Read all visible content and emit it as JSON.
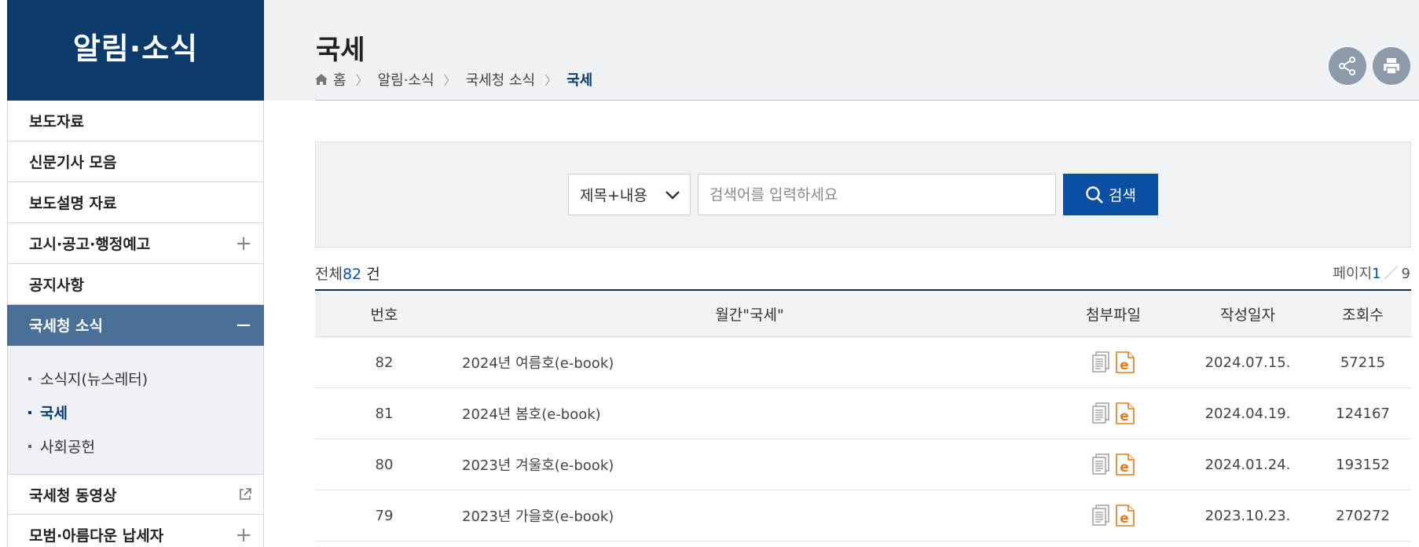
{
  "sidebar": {
    "title": "알림·소식",
    "items": [
      {
        "label": "보도자료",
        "icon": ""
      },
      {
        "label": "신문기사 모음",
        "icon": ""
      },
      {
        "label": "보도설명 자료",
        "icon": ""
      },
      {
        "label": "고시·공고·행정예고",
        "icon": "+"
      },
      {
        "label": "공지사항",
        "icon": ""
      },
      {
        "label": "국세청 소식",
        "icon": "−"
      }
    ],
    "submenu": [
      "소식지(뉴스레터)",
      "국세",
      "사회공헌"
    ],
    "bottom_items": [
      {
        "label": "국세청 동영상"
      },
      {
        "label": "모범·아름다운 납세자",
        "icon": "+"
      }
    ]
  },
  "header": {
    "title": "국세",
    "breadcrumb": [
      "홈",
      "알림·소식",
      "국세청 소식",
      "국세"
    ]
  },
  "search": {
    "select_value": "제목+내용",
    "placeholder": "검색어를 입력하세요",
    "button_label": "검색"
  },
  "summary": {
    "total_label": "전체",
    "total_count": "82",
    "total_unit": " 건",
    "page_label": "페이지",
    "page_current": "1",
    "page_sep": "／",
    "page_total": "9"
  },
  "table": {
    "headers": {
      "no": "번호",
      "title": "월간\"국세\"",
      "file": "첨부파일",
      "date": "작성일자",
      "views": "조회수"
    },
    "rows": [
      {
        "no": "82",
        "title": "2024년 여름호(e-book)",
        "date": "2024.07.15.",
        "views": "57215"
      },
      {
        "no": "81",
        "title": "2024년 봄호(e-book)",
        "date": "2024.04.19.",
        "views": "124167"
      },
      {
        "no": "80",
        "title": "2023년 겨울호(e-book)",
        "date": "2024.01.24.",
        "views": "193152"
      },
      {
        "no": "79",
        "title": "2023년 가을호(e-book)",
        "date": "2023.10.23.",
        "views": "270272"
      }
    ]
  },
  "colors": {
    "brand_navy": "#0b3a6b",
    "active_menu": "#4b7098",
    "search_button": "#0b4fa3",
    "ebook_orange": "#e07b1a"
  }
}
